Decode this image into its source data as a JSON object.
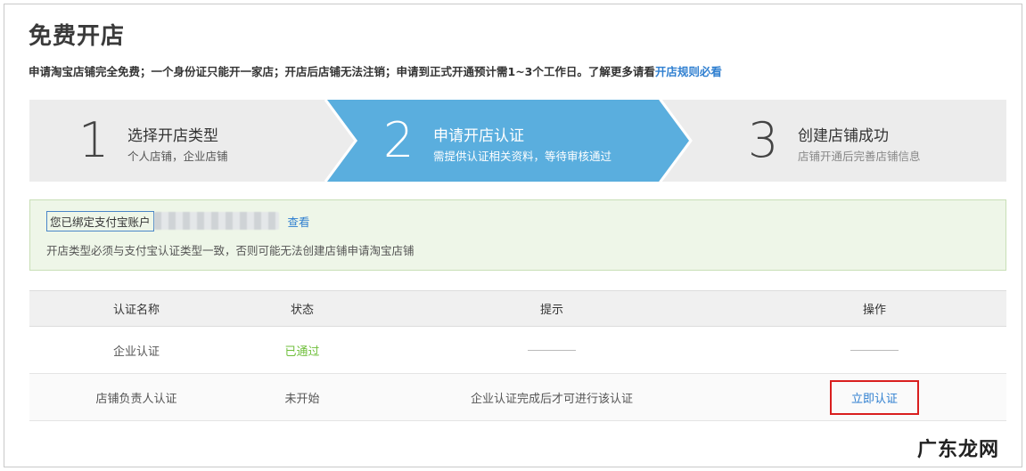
{
  "page": {
    "title": "免费开店"
  },
  "notice": {
    "text": "申请淘宝店铺完全免费；一个身份证只能开一家店；开店后店铺无法注销；申请到正式开通预计需1~3个工作日。了解更多请看",
    "link": "开店规则必看"
  },
  "steps": [
    {
      "number": "1",
      "title": "选择开店类型",
      "subtitle": "个人店铺，企业店铺",
      "state": "done"
    },
    {
      "number": "2",
      "title": "申请开店认证",
      "subtitle": "需提供认证相关资料，等待审核通过",
      "state": "active"
    },
    {
      "number": "3",
      "title": "创建店铺成功",
      "subtitle": "店铺开通后完善店铺信息",
      "state": "pending"
    }
  ],
  "colors": {
    "active_step": "#5aaede",
    "inactive_step": "#ececec",
    "link": "#2f7fd0",
    "pass": "#6fbf3b",
    "highlight_border": "#d91e1e"
  },
  "info": {
    "bind_label": "您已绑定支付宝账户",
    "view_link": "查看",
    "warning": "开店类型必须与支付宝认证类型一致，否则可能无法创建店铺申请淘宝店铺"
  },
  "table": {
    "headers": [
      "认证名称",
      "状态",
      "提示",
      "操作"
    ],
    "rows": [
      {
        "name": "企业认证",
        "status": "已通过"
      },
      {
        "name": "店铺负责人认证",
        "status": "未开始",
        "hint": "企业认证完成后才可进行该认证",
        "action": "立即认证"
      }
    ]
  },
  "watermark": "广东龙网"
}
